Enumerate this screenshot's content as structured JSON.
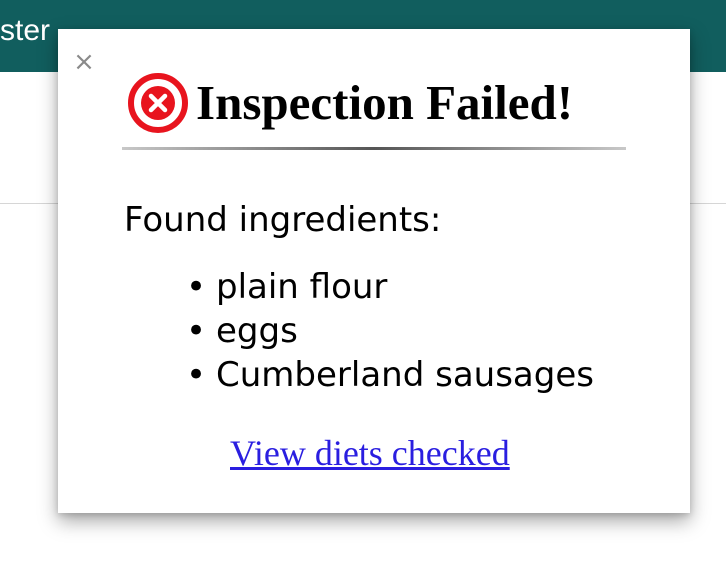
{
  "background_page": {
    "topbar_text": "ster",
    "topbar_color": "#115e5e"
  },
  "modal": {
    "close_label": "×",
    "title": "Inspection Failed!",
    "status_icon": "error-circle-x-icon",
    "status_color": "#e8141e",
    "found_label": "Found ingredients:",
    "ingredients": [
      "plain flour",
      "eggs",
      "Cumberland sausages"
    ],
    "link_label": "View diets checked",
    "link_color": "#2a1ee0"
  }
}
